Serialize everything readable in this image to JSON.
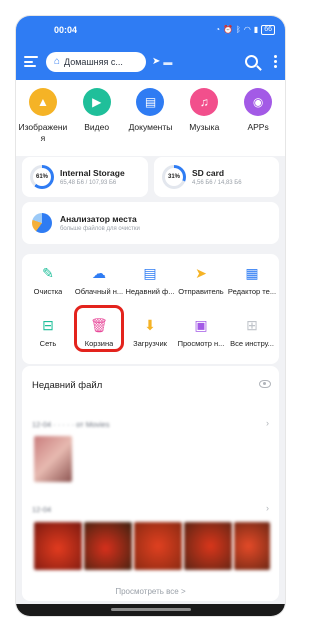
{
  "status": {
    "time": "00:04",
    "battery": "66"
  },
  "appbar": {
    "breadcrumb": "Домашняя с..."
  },
  "categories": [
    {
      "label": "Изображени я",
      "icon": "image-icon",
      "color": "#f5b326"
    },
    {
      "label": "Видео",
      "icon": "video-icon",
      "color": "#1fbf9a"
    },
    {
      "label": "Документы",
      "icon": "document-icon",
      "color": "#2f7cf3"
    },
    {
      "label": "Музыка",
      "icon": "music-icon",
      "color": "#f24f8c"
    },
    {
      "label": "APPs",
      "icon": "android-icon",
      "color": "#a35ae6"
    }
  ],
  "storage": {
    "internal": {
      "percent": "61%",
      "title": "Internal Storage",
      "sub": "65,48 Б6 / 107,93 Б6",
      "fill": 0.61
    },
    "sd": {
      "percent": "31%",
      "title": "SD card",
      "sub": "4,56 Б6 / 14,83 Б6",
      "fill": 0.31
    }
  },
  "analyzer": {
    "title": "Анализатор места",
    "sub": "больше файлов для очистки"
  },
  "tools": [
    {
      "label": "Очистка",
      "icon": "broom-icon",
      "color": "#1fbf9a"
    },
    {
      "label": "Облачный н...",
      "icon": "cloud-icon",
      "color": "#2f7cf3"
    },
    {
      "label": "Недавний ф...",
      "icon": "recent-file-icon",
      "color": "#2f7cf3"
    },
    {
      "label": "Отправитель",
      "icon": "send-icon",
      "color": "#f5b326"
    },
    {
      "label": "Редактор те...",
      "icon": "text-editor-icon",
      "color": "#2f7cf3"
    },
    {
      "label": "Сеть",
      "icon": "network-icon",
      "color": "#1fbf9a"
    },
    {
      "label": "Корзина",
      "icon": "trash-icon",
      "color": "#e84a9a"
    },
    {
      "label": "Загрузчик",
      "icon": "download-icon",
      "color": "#f5b326"
    },
    {
      "label": "Просмотр н...",
      "icon": "viewer-icon",
      "color": "#a35ae6"
    },
    {
      "label": "Все инстру...",
      "icon": "grid-icon",
      "color": "#c0c4ca"
    }
  ],
  "recent": {
    "title": "Недавний файл",
    "group1": "12-04 · · · · · от Movies",
    "group2": "12-04",
    "view_all": "Просмотреть все >"
  }
}
